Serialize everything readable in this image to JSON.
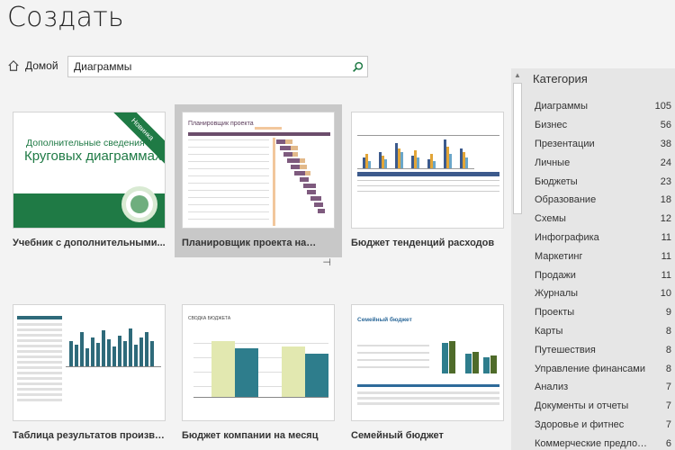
{
  "page_title": "Создать",
  "home_label": "Домой",
  "search": {
    "value": "Диаграммы",
    "placeholder": ""
  },
  "templates": [
    {
      "label": "Учебник с дополнительными...",
      "thumb_lines": [
        "Дополнительные сведения о",
        "Круговых диаграммах"
      ],
      "badge": "Новинка"
    },
    {
      "label": "Планировщик проекта на диа...",
      "thumb_title": "Планировщик проекта"
    },
    {
      "label": "Бюджет тенденций расходов"
    },
    {
      "label": "Таблица результатов произво..."
    },
    {
      "label": "Бюджет компании на месяц",
      "thumb_title": "СВОДКА БЮДЖЕТА"
    },
    {
      "label": "Семейный бюджет",
      "thumb_title": "Семейный бюджет"
    }
  ],
  "category": {
    "header": "Категория",
    "items": [
      {
        "name": "Диаграммы",
        "count": "105"
      },
      {
        "name": "Бизнес",
        "count": "56"
      },
      {
        "name": "Презентации",
        "count": "38"
      },
      {
        "name": "Личные",
        "count": "24"
      },
      {
        "name": "Бюджеты",
        "count": "23"
      },
      {
        "name": "Образование",
        "count": "18"
      },
      {
        "name": "Схемы",
        "count": "12"
      },
      {
        "name": "Инфографика",
        "count": "11"
      },
      {
        "name": "Маркетинг",
        "count": "11"
      },
      {
        "name": "Продажи",
        "count": "11"
      },
      {
        "name": "Журналы",
        "count": "10"
      },
      {
        "name": "Проекты",
        "count": "9"
      },
      {
        "name": "Карты",
        "count": "8"
      },
      {
        "name": "Путешествия",
        "count": "8"
      },
      {
        "name": "Управление финансами",
        "count": "8"
      },
      {
        "name": "Анализ",
        "count": "7"
      },
      {
        "name": "Документы и отчеты",
        "count": "7"
      },
      {
        "name": "Здоровье и фитнес",
        "count": "7"
      },
      {
        "name": "Коммерческие предложения",
        "count": "6"
      }
    ]
  },
  "colors": {
    "accent_green": "#1f7a45",
    "teal": "#2e7d8c",
    "olive": "#4f6b2a"
  }
}
